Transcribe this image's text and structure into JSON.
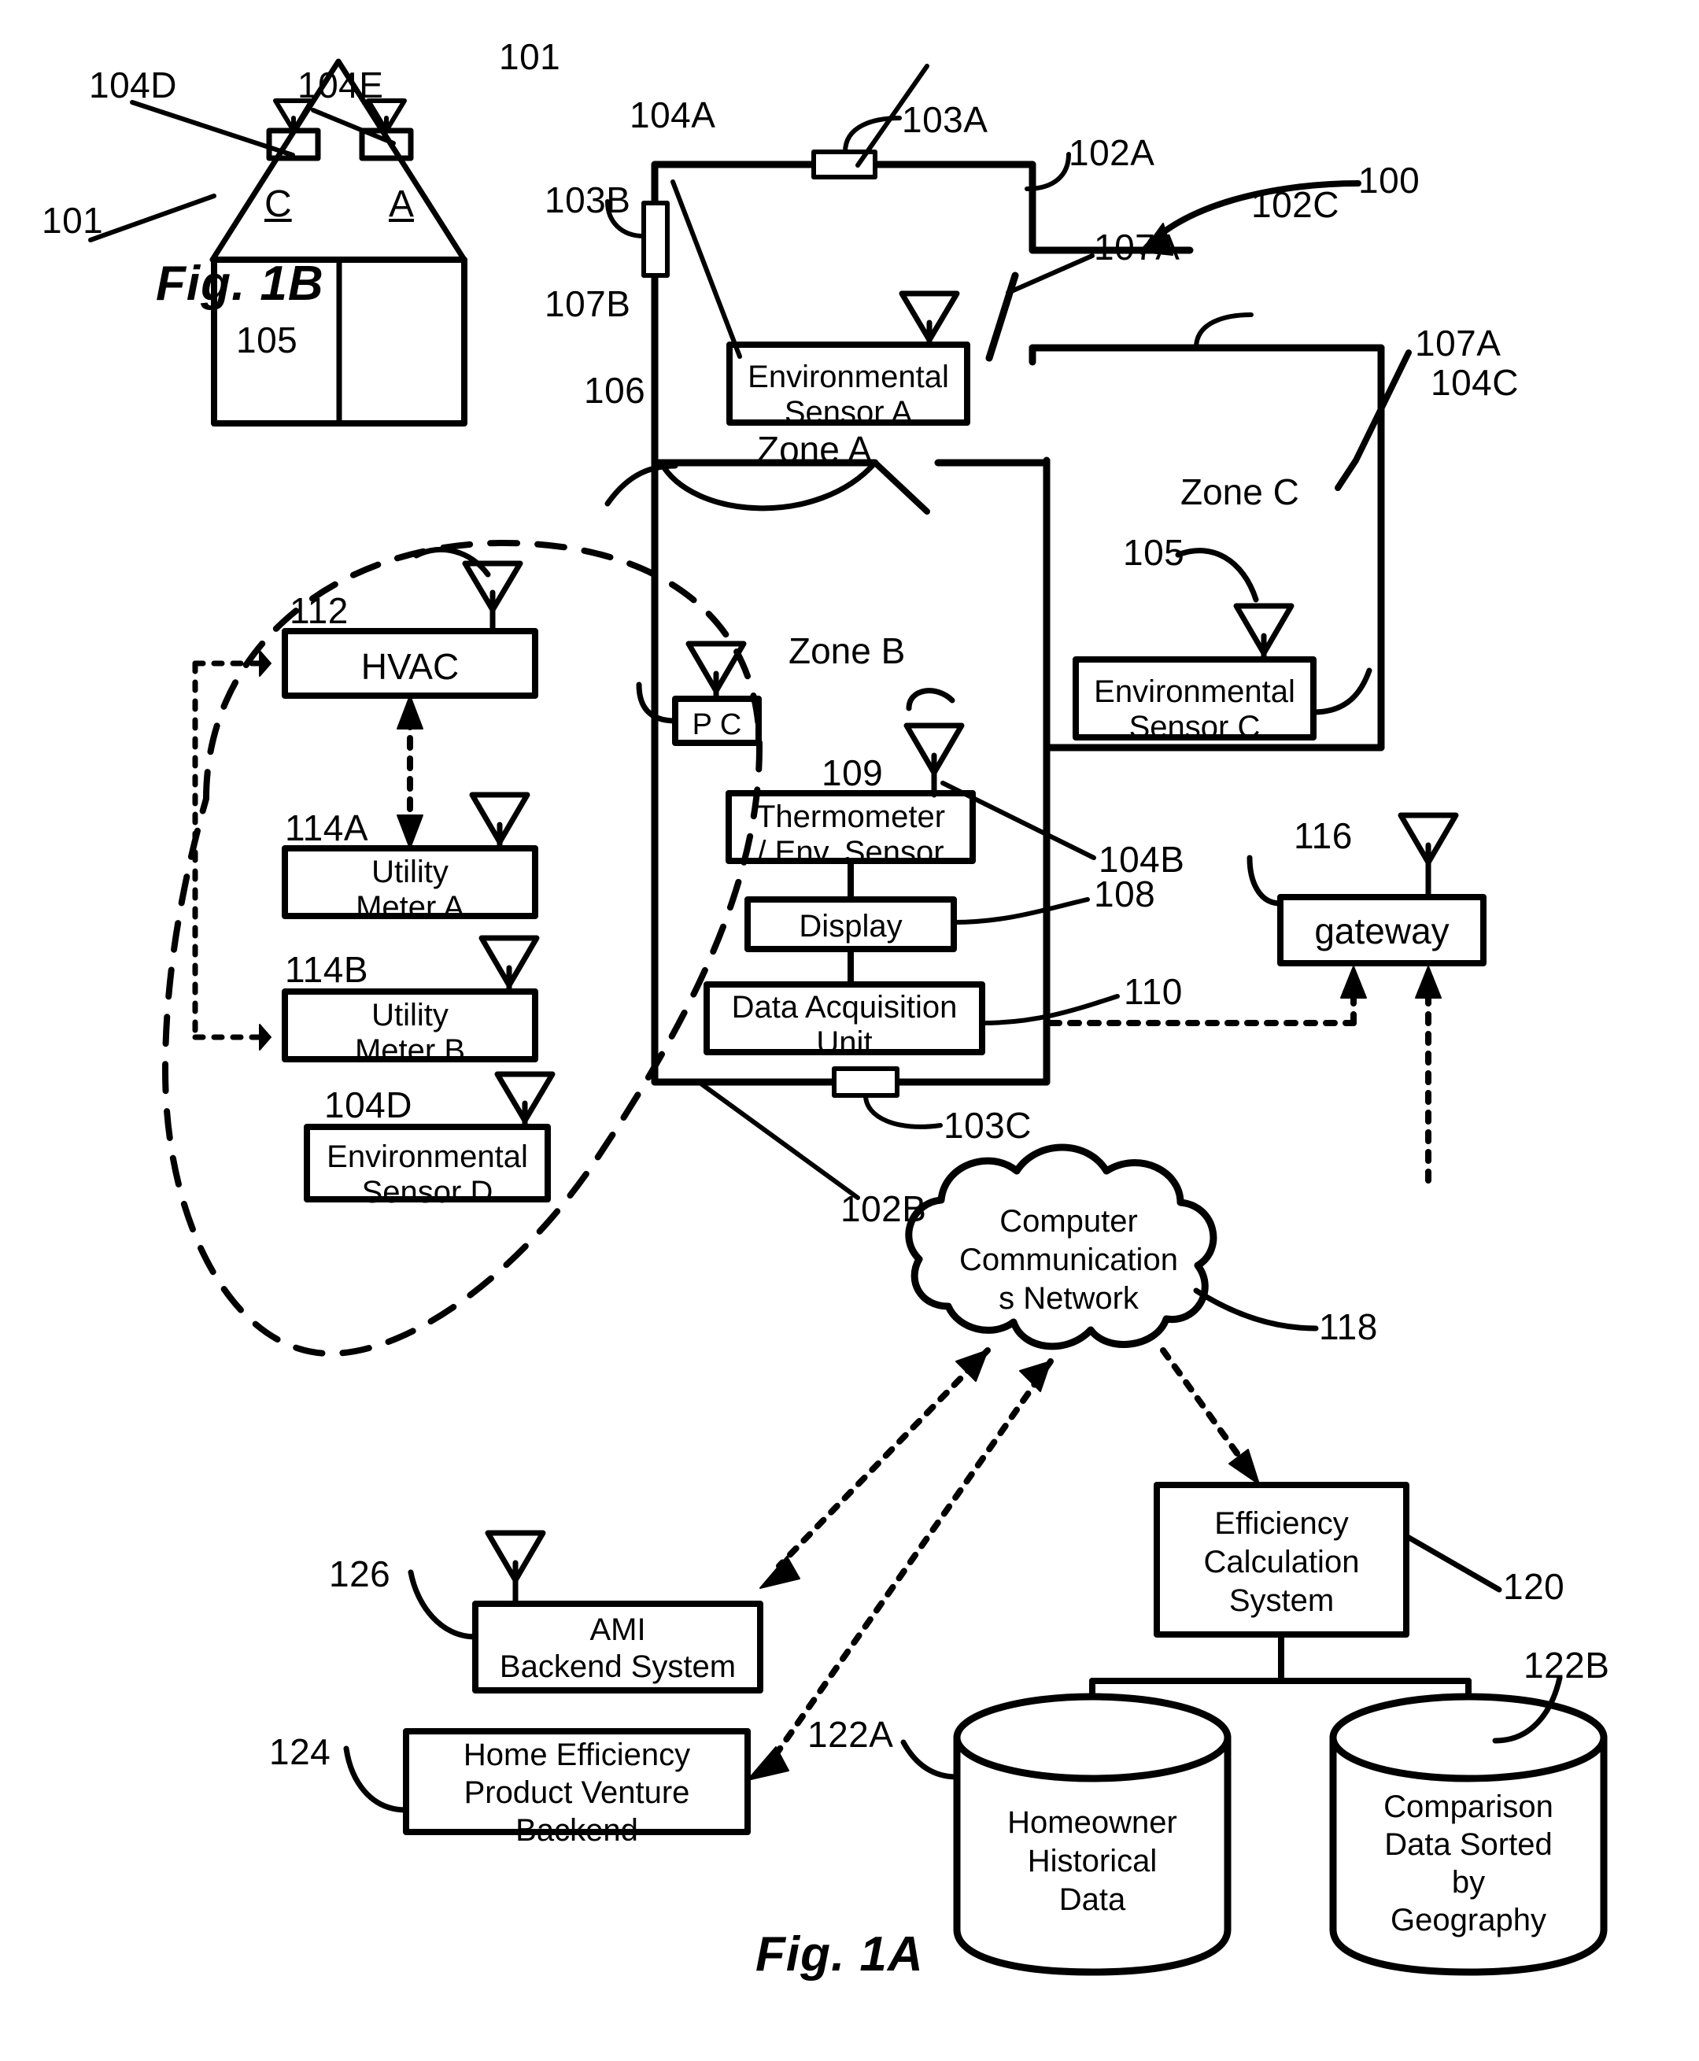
{
  "figures": {
    "fig_1a_label": "Fig. 1A",
    "fig_1b_label": "Fig. 1B"
  },
  "fig1b": {
    "ref_104d": "104D",
    "ref_104e": "104E",
    "ref_101": "101",
    "cell_left": "C",
    "cell_right": "A"
  },
  "fig1a": {
    "ref_100": "100",
    "ref_101": "101",
    "ref_102a": "102A",
    "ref_102b": "102B",
    "ref_102c": "102C",
    "ref_103a": "103A",
    "ref_103b": "103B",
    "ref_103c": "103C",
    "ref_104a": "104A",
    "ref_104b": "104B",
    "ref_104c": "104C",
    "ref_104d": "104D",
    "ref_105_left": "105",
    "ref_105_right": "105",
    "ref_106": "106",
    "ref_107a_top": "107A",
    "ref_107a_zonec": "107A",
    "ref_107b": "107B",
    "ref_108": "108",
    "ref_109": "109",
    "ref_110": "110",
    "ref_112": "112",
    "ref_114a": "114A",
    "ref_114b": "114B",
    "ref_116": "116",
    "ref_118": "118",
    "ref_120": "120",
    "ref_122a": "122A",
    "ref_122b": "122B",
    "ref_124": "124",
    "ref_126": "126",
    "zone_a": "Zone A",
    "zone_b": "Zone B",
    "zone_c": "Zone C",
    "boxes": {
      "env_sensor_a": "Environmental\nSensor A",
      "env_sensor_a_l1": "Environmental",
      "env_sensor_a_l2": "Sensor A",
      "env_sensor_c_l1": "Environmental",
      "env_sensor_c_l2": "Sensor C",
      "env_sensor_d_l1": "Environmental",
      "env_sensor_d_l2": "Sensor D",
      "pc": "P C",
      "thermometer_l1": "Thermometer",
      "thermometer_l2": "/ Env. Sensor",
      "display": "Display",
      "dau_l1": "Data Acquisition",
      "dau_l2": "Unit",
      "hvac": "HVAC",
      "utility_meter_a_l1": "Utility",
      "utility_meter_a_l2": "Meter A",
      "utility_meter_b_l1": "Utility",
      "utility_meter_b_l2": "Meter B",
      "gateway": "gateway",
      "cloud_l1": "Computer",
      "cloud_l2": "Communication",
      "cloud_l3": "s Network",
      "efficiency_l1": "Efficiency",
      "efficiency_l2": "Calculation",
      "efficiency_l3": "System",
      "ami_l1": "AMI",
      "ami_l2": "Backend System",
      "hepv_l1": "Home Efficiency",
      "hepv_l2": "Product Venture",
      "hepv_l3": "Backend",
      "db_homeowner_l1": "Homeowner",
      "db_homeowner_l2": "Historical",
      "db_homeowner_l3": "Data",
      "db_comparison_l1": "Comparison",
      "db_comparison_l2": "Data Sorted",
      "db_comparison_l3": "by",
      "db_comparison_l4": "Geography"
    }
  },
  "colors": {
    "ink": "#000000",
    "paper": "#ffffff"
  }
}
